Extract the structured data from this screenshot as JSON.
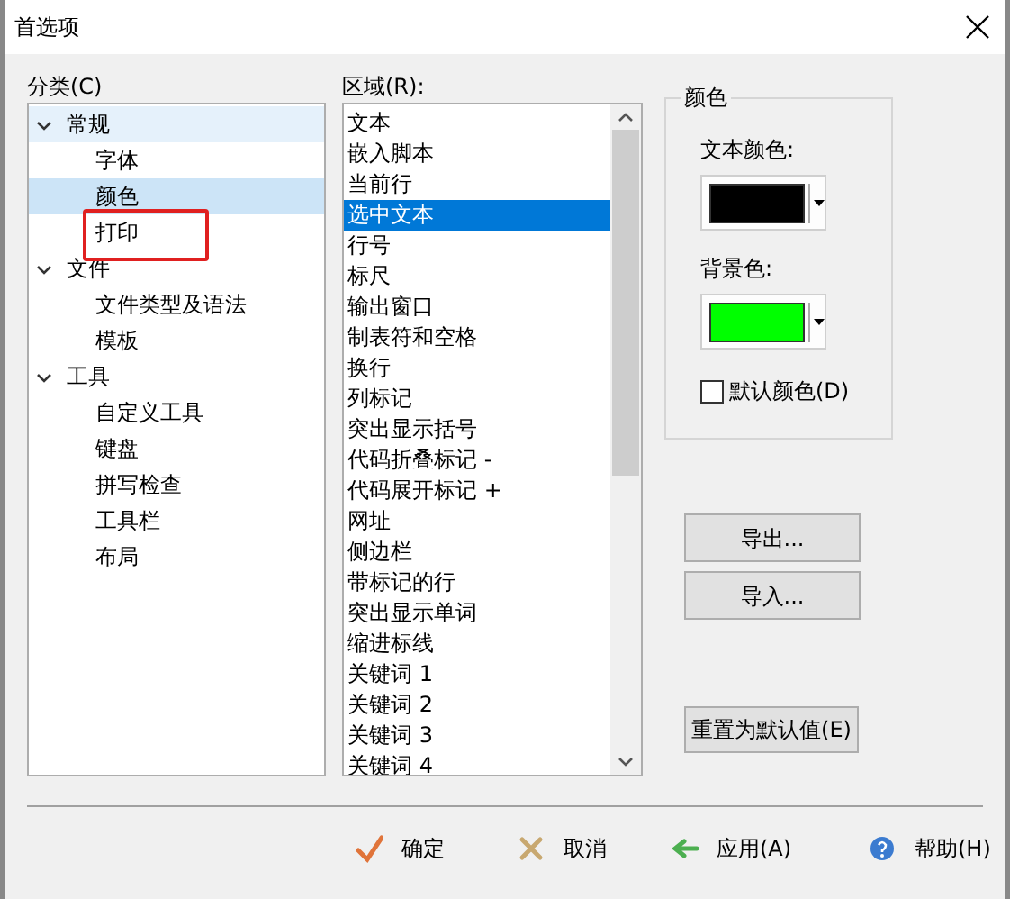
{
  "window": {
    "title": "首选项"
  },
  "category": {
    "label": "分类(C)",
    "tree": [
      {
        "label": "常规",
        "expanded": true,
        "selected": false,
        "hovered": true,
        "children": [
          {
            "label": "字体",
            "selected": false
          },
          {
            "label": "颜色",
            "selected": true
          },
          {
            "label": "打印",
            "selected": false,
            "annotated": true
          }
        ]
      },
      {
        "label": "文件",
        "expanded": true,
        "selected": false,
        "hovered": false,
        "children": [
          {
            "label": "文件类型及语法",
            "selected": false
          },
          {
            "label": "模板",
            "selected": false
          }
        ]
      },
      {
        "label": "工具",
        "expanded": true,
        "selected": false,
        "hovered": false,
        "children": [
          {
            "label": "自定义工具",
            "selected": false
          },
          {
            "label": "键盘",
            "selected": false
          },
          {
            "label": "拼写检查",
            "selected": false
          },
          {
            "label": "工具栏",
            "selected": false
          },
          {
            "label": "布局",
            "selected": false
          }
        ]
      }
    ]
  },
  "area": {
    "label": "区域(R):",
    "items": [
      {
        "label": "文本",
        "selected": false
      },
      {
        "label": "嵌入脚本",
        "selected": false
      },
      {
        "label": "当前行",
        "selected": false
      },
      {
        "label": "选中文本",
        "selected": true
      },
      {
        "label": "行号",
        "selected": false
      },
      {
        "label": "标尺",
        "selected": false
      },
      {
        "label": "输出窗口",
        "selected": false
      },
      {
        "label": "制表符和空格",
        "selected": false
      },
      {
        "label": "换行",
        "selected": false
      },
      {
        "label": "列标记",
        "selected": false
      },
      {
        "label": "突出显示括号",
        "selected": false
      },
      {
        "label": "代码折叠标记 -",
        "selected": false
      },
      {
        "label": "代码展开标记 +",
        "selected": false
      },
      {
        "label": "网址",
        "selected": false
      },
      {
        "label": "侧边栏",
        "selected": false
      },
      {
        "label": "带标记的行",
        "selected": false
      },
      {
        "label": "突出显示单词",
        "selected": false
      },
      {
        "label": "缩进标线",
        "selected": false
      },
      {
        "label": "关键词 1",
        "selected": false
      },
      {
        "label": "关键词 2",
        "selected": false
      },
      {
        "label": "关键词 3",
        "selected": false
      },
      {
        "label": "关键词 4",
        "selected": false
      }
    ]
  },
  "colors": {
    "title": "颜色",
    "pickers": [
      {
        "label": "文本颜色:",
        "color": "#000000"
      },
      {
        "label": "背景色:",
        "color": "#00ff00"
      }
    ],
    "default_colors": {
      "label": "默认颜色(D)",
      "checked": false
    }
  },
  "side_buttons": [
    "导出...",
    "导入..."
  ],
  "reset_button": "重置为默认值(E)",
  "footer_buttons": [
    {
      "kind": "ok",
      "label": "确定"
    },
    {
      "kind": "cancel",
      "label": "取消"
    },
    {
      "kind": "apply",
      "label": "应用(A)"
    },
    {
      "kind": "help",
      "label": "帮助(H)"
    }
  ]
}
